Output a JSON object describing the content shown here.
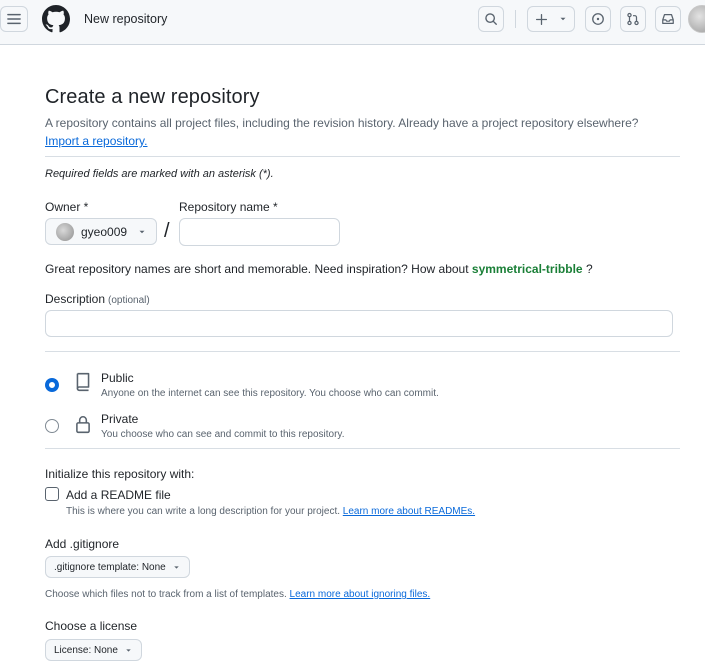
{
  "header": {
    "title": "New repository"
  },
  "page": {
    "title": "Create a new repository",
    "description": "A repository contains all project files, including the revision history. Already have a project repository elsewhere?",
    "import_link": "Import a repository.",
    "required_note": "Required fields are marked with an asterisk (*)."
  },
  "owner": {
    "label": "Owner *",
    "value": "gyeo009"
  },
  "repo_name": {
    "label": "Repository name *",
    "value": ""
  },
  "inspiration": {
    "text": "Great repository names are short and memorable. Need inspiration? How about ",
    "suggestion": "symmetrical-tribble",
    "suffix": " ?"
  },
  "description": {
    "label": "Description",
    "optional": "(optional)",
    "value": ""
  },
  "visibility": {
    "selected": "public",
    "public": {
      "title": "Public",
      "desc": "Anyone on the internet can see this repository. You choose who can commit."
    },
    "private": {
      "title": "Private",
      "desc": "You choose who can see and commit to this repository."
    }
  },
  "initialize": {
    "title": "Initialize this repository with:",
    "readme_label": "Add a README file",
    "readme_checked": false,
    "readme_desc": "This is where you can write a long description for your project. ",
    "readme_link": "Learn more about READMEs."
  },
  "gitignore": {
    "title": "Add .gitignore",
    "button": ".gitignore template: None",
    "desc": "Choose which files not to track from a list of templates. ",
    "link": "Learn more about ignoring files."
  },
  "license": {
    "title": "Choose a license",
    "button": "License: None"
  },
  "colors": {
    "accent": "#0969da",
    "suggestion": "#1a7f37",
    "border": "#d0d7de"
  },
  "icons": [
    "hamburger-icon",
    "github-logo-icon",
    "search-icon",
    "plus-icon",
    "chevron-down-icon",
    "issue-icon",
    "pull-request-icon",
    "inbox-icon",
    "repo-icon",
    "lock-icon"
  ]
}
